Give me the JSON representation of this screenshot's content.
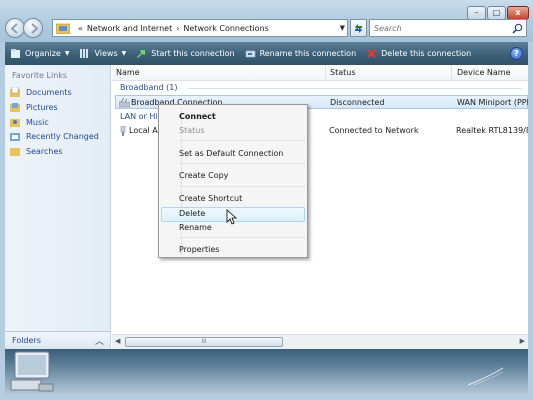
{
  "window": {
    "minimize_glyph": "–",
    "maximize_glyph": "□",
    "close_glyph": "x"
  },
  "address_bar": {
    "separator": "«",
    "crumbs": [
      "Network and Internet",
      "Network Connections"
    ],
    "crumb_sep": "›"
  },
  "search": {
    "placeholder": "Search"
  },
  "toolbar": {
    "organize": "Organize",
    "views": "Views",
    "start": "Start this connection",
    "rename": "Rename this connection",
    "delete": "Delete this connection",
    "help": "?"
  },
  "nav_pane": {
    "favorite_links_title": "Favorite Links",
    "items": [
      {
        "label": "Documents",
        "icon": "documents-folder-icon"
      },
      {
        "label": "Pictures",
        "icon": "pictures-folder-icon"
      },
      {
        "label": "Music",
        "icon": "music-folder-icon"
      },
      {
        "label": "Recently Changed",
        "icon": "recently-changed-folder-icon"
      },
      {
        "label": "Searches",
        "icon": "searches-folder-icon"
      }
    ],
    "folders_label": "Folders"
  },
  "columns": {
    "name": "Name",
    "status": "Status",
    "device": "Device Name"
  },
  "groups": {
    "broadband": "Broadband (1)",
    "lan": "LAN or Hig"
  },
  "rows": [
    {
      "name": "Broadband Connection",
      "status": "Disconnected",
      "device": "WAN Miniport (PPP"
    },
    {
      "name": "Local Ar",
      "status": "Connected to Network",
      "device": "Realtek RTL8139/810"
    }
  ],
  "context_menu": {
    "connect": "Connect",
    "status": "Status",
    "set_default": "Set as Default Connection",
    "create_copy": "Create Copy",
    "create_shortcut": "Create Shortcut",
    "delete": "Delete",
    "rename": "Rename",
    "properties": "Properties"
  },
  "scrollbar": {
    "grip": "III"
  },
  "colors": {
    "toolbar": "#3f6279",
    "link": "#1e4a9a",
    "hover": "#dcf0fb"
  }
}
